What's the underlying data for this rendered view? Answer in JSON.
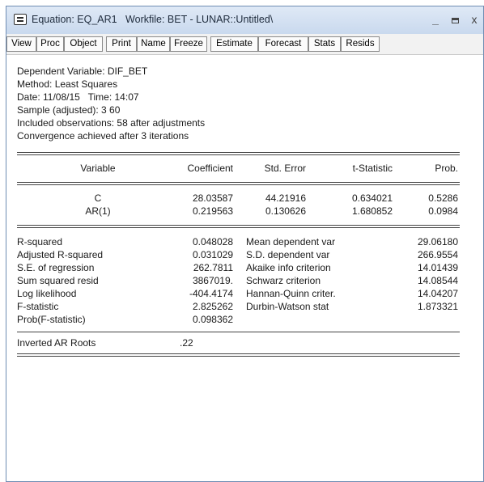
{
  "window": {
    "title": "Equation: EQ_AR1   Workfile: BET - LUNAR::Untitled\\",
    "icon": "equation-window-icon",
    "controls": {
      "minimize": "_",
      "close": "x"
    }
  },
  "toolbar": {
    "buttons": [
      "View",
      "Proc",
      "Object",
      "Print",
      "Name",
      "Freeze",
      "Estimate",
      "Forecast",
      "Stats",
      "Resids"
    ]
  },
  "header": {
    "dependent": "Dependent Variable: DIF_BET",
    "method": "Method: Least Squares",
    "datetime": "Date: 11/08/15   Time: 14:07",
    "sample": "Sample (adjusted): 3 60",
    "observations": "Included observations: 58 after adjustments",
    "convergence": "Convergence achieved after 3 iterations"
  },
  "coef_table": {
    "columns": [
      "Variable",
      "Coefficient",
      "Std. Error",
      "t-Statistic",
      "Prob."
    ],
    "rows": [
      [
        "C",
        "28.03587",
        "44.21916",
        "0.634021",
        "0.5286"
      ],
      [
        "AR(1)",
        "0.219563",
        "0.130626",
        "1.680852",
        "0.0984"
      ]
    ]
  },
  "stats": {
    "left": [
      {
        "label": "R-squared",
        "value": "0.048028"
      },
      {
        "label": "Adjusted R-squared",
        "value": "0.031029"
      },
      {
        "label": "S.E. of regression",
        "value": "262.7811"
      },
      {
        "label": "Sum squared resid",
        "value": "3867019."
      },
      {
        "label": "Log likelihood",
        "value": "-404.4174"
      },
      {
        "label": "F-statistic",
        "value": "2.825262"
      },
      {
        "label": "Prob(F-statistic)",
        "value": "0.098362"
      }
    ],
    "right": [
      {
        "label": "Mean dependent var",
        "value": "29.06180"
      },
      {
        "label": "S.D. dependent var",
        "value": "266.9554"
      },
      {
        "label": "Akaike info criterion",
        "value": "14.01439"
      },
      {
        "label": "Schwarz criterion",
        "value": "14.08544"
      },
      {
        "label": "Hannan-Quinn criter.",
        "value": "14.04207"
      },
      {
        "label": "Durbin-Watson stat",
        "value": "1.873321"
      }
    ]
  },
  "roots": {
    "label": "Inverted AR Roots",
    "value": ".22"
  }
}
